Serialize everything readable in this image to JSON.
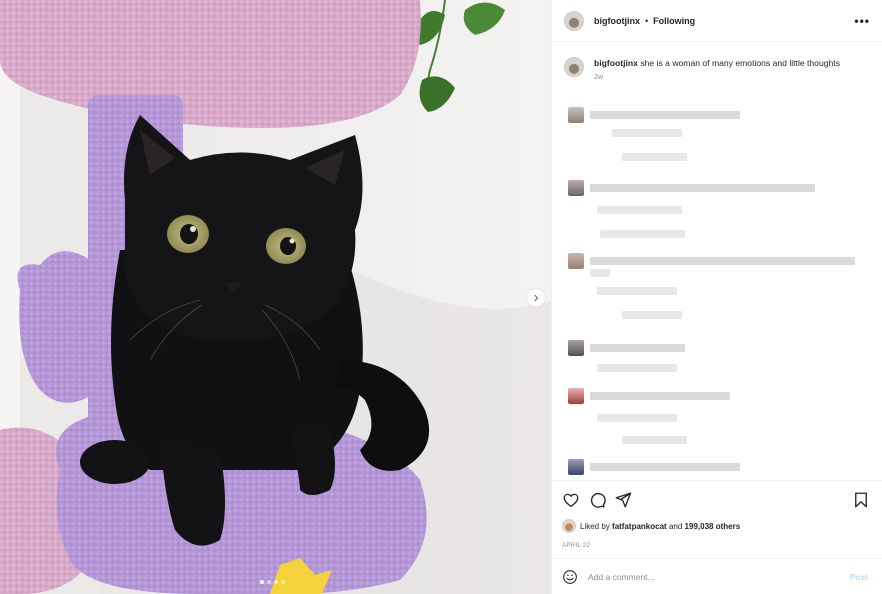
{
  "post": {
    "username": "bigfootjinx",
    "separator": "•",
    "follow_status": "Following",
    "more_icon": "more-horizontal-icon",
    "caption_username": "bigfootjinx",
    "caption_text": "she is a woman of many emotions and little thoughts",
    "caption_time": "2w"
  },
  "media": {
    "subject": "black cat on purple cat tree",
    "carousel_next_icon": "chevron-right-icon",
    "slide_count": 4,
    "active_slide": 1
  },
  "actions": {
    "like_icon": "heart-icon",
    "comment_icon": "comment-icon",
    "share_icon": "share-icon",
    "save_icon": "bookmark-icon"
  },
  "likes": {
    "prefix": "Liked by",
    "user": "fatfatpankocat",
    "connector": "and",
    "count": "199,038 others"
  },
  "date": "APRIL 22",
  "add_comment": {
    "placeholder": "Add a comment...",
    "post_label": "Post",
    "emoji_icon": "emoji-icon"
  },
  "colors": {
    "post_button": "#b2dffc",
    "muted_text": "#8e8e8e",
    "border": "#efefef"
  }
}
